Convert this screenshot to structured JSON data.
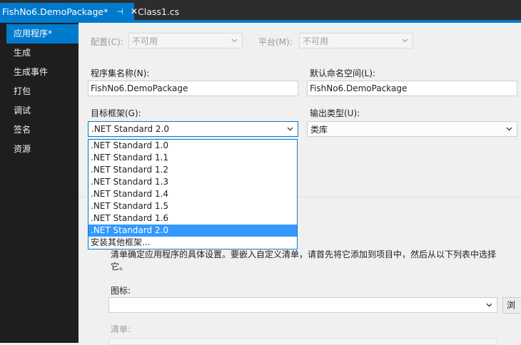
{
  "tabs": {
    "active": {
      "title": "FishNo6.DemoPackage*",
      "pin": "⊣",
      "close": "✕"
    },
    "inactive": {
      "title": "Class1.cs"
    }
  },
  "colors": {
    "accent": "#007acc",
    "sidebar_bg": "#1e1e1e",
    "selected": "#3399ff"
  },
  "sidebar": {
    "items": [
      {
        "label": "应用程序*",
        "active": true
      },
      {
        "label": "生成"
      },
      {
        "label": "生成事件"
      },
      {
        "label": "打包"
      },
      {
        "label": "调试"
      },
      {
        "label": "签名"
      },
      {
        "label": "资源"
      }
    ]
  },
  "config": {
    "label": "配置(C):",
    "value": "不可用"
  },
  "platform": {
    "label": "平台(M):",
    "value": "不可用"
  },
  "assembly_name": {
    "label": "程序集名称(N):",
    "value": "FishNo6.DemoPackage"
  },
  "default_namespace": {
    "label": "默认命名空间(L):",
    "value": "FishNo6.DemoPackage"
  },
  "target_framework": {
    "label": "目标框架(G):",
    "value": ".NET Standard 2.0",
    "options": [
      ".NET Standard 1.0",
      ".NET Standard 1.1",
      ".NET Standard 1.2",
      ".NET Standard 1.3",
      ".NET Standard 1.4",
      ".NET Standard 1.5",
      ".NET Standard 1.6",
      ".NET Standard 2.0",
      "安装其他框架..."
    ],
    "selected_index": 7
  },
  "output_type": {
    "label": "输出类型(U):",
    "value": "类库"
  },
  "manifest_description": "清单确定应用程序的具体设置。要嵌入自定义清单，请首先将它添加到项目中，然后从以下列表中选择它。",
  "icon": {
    "label": "图标:",
    "value": "",
    "browse_label": "浏览..."
  },
  "manifest": {
    "label": "清单:"
  }
}
